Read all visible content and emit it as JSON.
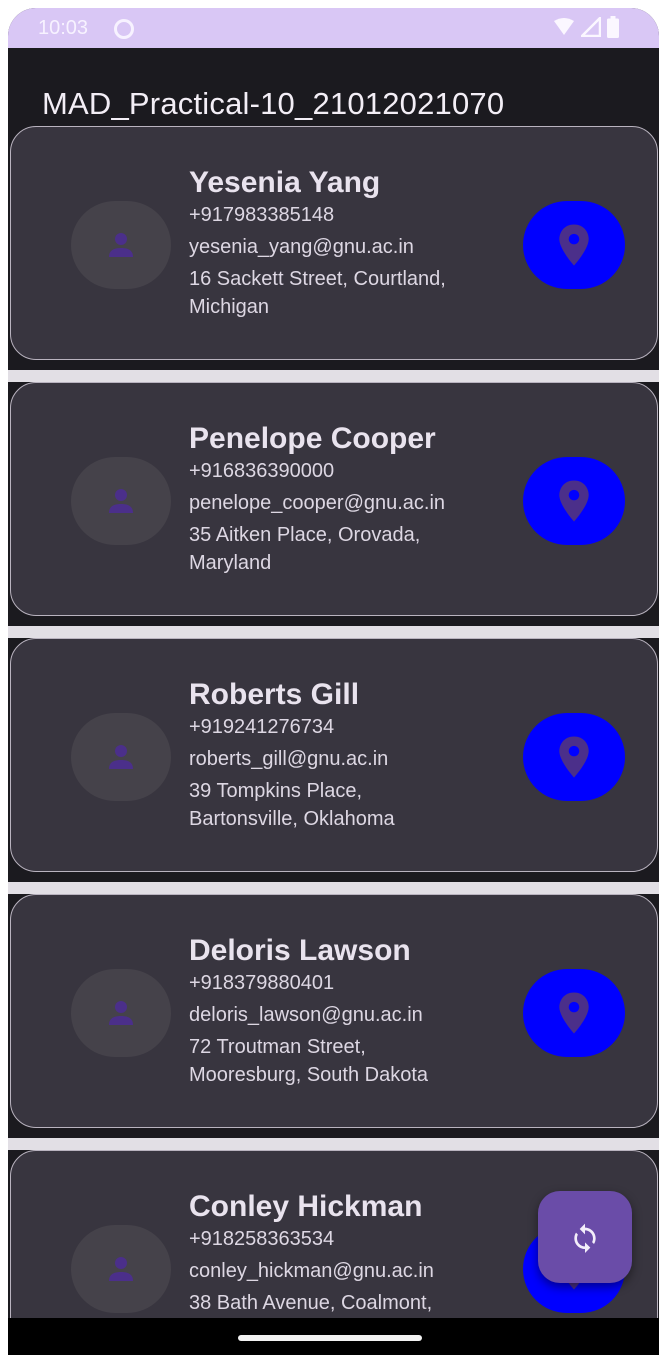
{
  "status_bar": {
    "time": "10:03",
    "icons": [
      "notification-circle-icon",
      "wifi-icon",
      "signal-icon",
      "battery-icon"
    ]
  },
  "app_bar": {
    "title": "MAD_Practical-10_21012021070"
  },
  "colors": {
    "status_bar": "#d9c7f5",
    "background": "#1b1a1f",
    "card": "#38353f",
    "card_border": "#b9b3bf",
    "map_button": "#0000ff",
    "map_icon": "#4b2f8a",
    "avatar_bg": "#45424a",
    "avatar_icon": "#4b2f8a",
    "fab": "#6a4ca8",
    "separator": "#e2dfe5"
  },
  "contacts": [
    {
      "name": "Yesenia Yang",
      "phone": "+917983385148",
      "email": "yesenia_yang@gnu.ac.in",
      "address_line1": "16 Sackett Street, Courtland,",
      "address_line2": "Michigan"
    },
    {
      "name": "Penelope Cooper",
      "phone": "+916836390000",
      "email": "penelope_cooper@gnu.ac.in",
      "address_line1": "35 Aitken Place, Orovada,",
      "address_line2": "Maryland"
    },
    {
      "name": "Roberts Gill",
      "phone": "+919241276734",
      "email": "roberts_gill@gnu.ac.in",
      "address_line1": "39 Tompkins Place,",
      "address_line2": "Bartonsville, Oklahoma"
    },
    {
      "name": "Deloris Lawson",
      "phone": "+918379880401",
      "email": "deloris_lawson@gnu.ac.in",
      "address_line1": "72 Troutman Street,",
      "address_line2": "Mooresburg, South Dakota"
    },
    {
      "name": "Conley Hickman",
      "phone": "+918258363534",
      "email": "conley_hickman@gnu.ac.in",
      "address_line1": "38 Bath Avenue, Coalmont,",
      "address_line2": ""
    }
  ],
  "fab": {
    "icon": "refresh-icon"
  }
}
